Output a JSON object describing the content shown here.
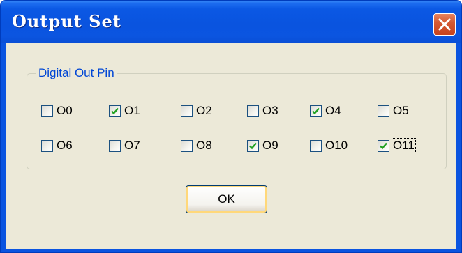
{
  "window": {
    "title": "Output Set",
    "close_icon": "close-icon"
  },
  "group": {
    "label": "Digital Out Pin",
    "rows": [
      [
        {
          "label": "O0",
          "checked": false
        },
        {
          "label": "O1",
          "checked": true
        },
        {
          "label": "O2",
          "checked": false
        },
        {
          "label": "O3",
          "checked": false
        },
        {
          "label": "O4",
          "checked": true
        },
        {
          "label": "O5",
          "checked": false
        }
      ],
      [
        {
          "label": "O6",
          "checked": false
        },
        {
          "label": "O7",
          "checked": false
        },
        {
          "label": "O8",
          "checked": false
        },
        {
          "label": "O9",
          "checked": true
        },
        {
          "label": "O10",
          "checked": false
        },
        {
          "label": "O11",
          "checked": true,
          "focused": true
        }
      ]
    ]
  },
  "buttons": {
    "ok_label": "OK"
  },
  "colors": {
    "titlebar": "#0a54e0",
    "dialog_face": "#ece9d8",
    "group_label": "#0046d5",
    "checkmark": "#21a121",
    "close_button": "#d45a35"
  }
}
